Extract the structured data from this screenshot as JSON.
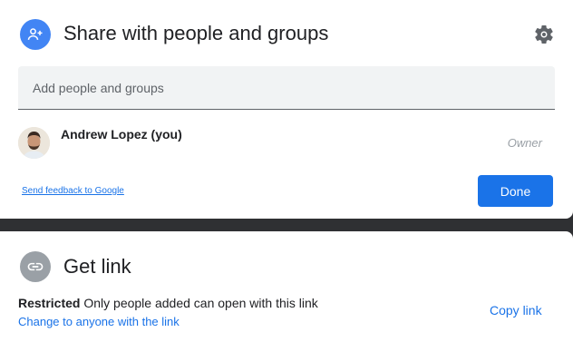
{
  "share": {
    "title": "Share with people and groups",
    "icon": "add-person-icon",
    "settings_icon": "gear-icon",
    "input_placeholder": "Add people and groups",
    "input_value": "",
    "people": [
      {
        "name": "Andrew Lopez (you)",
        "role": "Owner"
      }
    ],
    "feedback_link": "Send feedback to Google",
    "done_label": "Done"
  },
  "link": {
    "title": "Get link",
    "icon": "link-icon",
    "restriction_label": "Restricted",
    "restriction_desc": "Only people added can open with this link",
    "change_label": "Change to anyone with the link",
    "copy_label": "Copy link"
  },
  "colors": {
    "accent": "#1a73e8",
    "add_person_circle": "#4285f4",
    "link_circle": "#9aa0a6",
    "backdrop": "#2f3033"
  }
}
